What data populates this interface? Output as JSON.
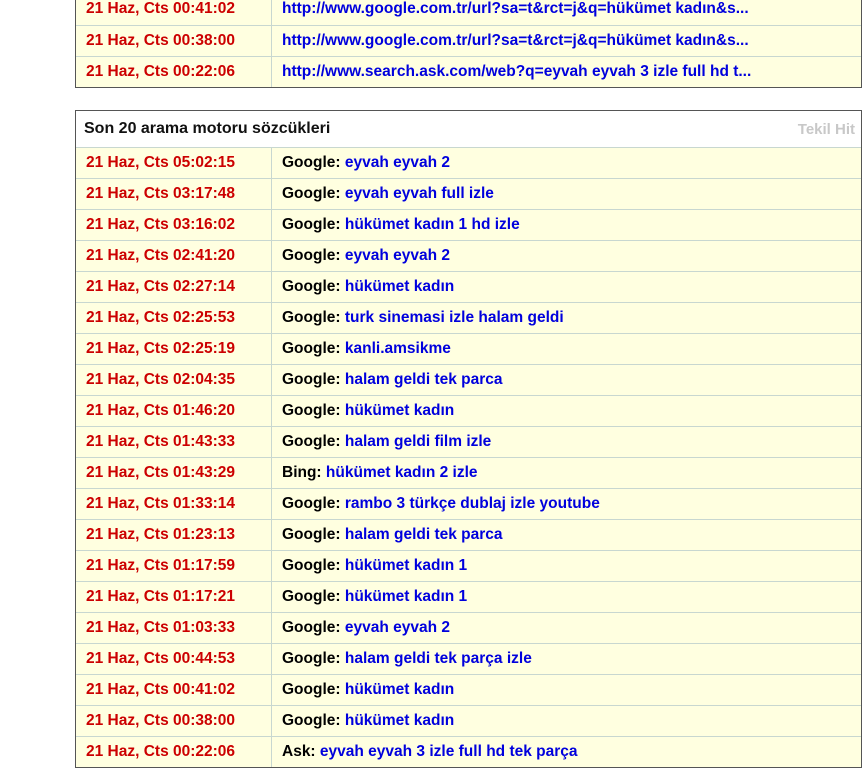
{
  "referrers": [
    {
      "date": "21 Haz, Cts 00:41:02",
      "url": "http://www.google.com.tr/url?sa=t&rct=j&q=hükümet kadın&s..."
    },
    {
      "date": "21 Haz, Cts 00:38:00",
      "url": "http://www.google.com.tr/url?sa=t&rct=j&q=hükümet kadın&s..."
    },
    {
      "date": "21 Haz, Cts 00:22:06",
      "url": "http://www.search.ask.com/web?q=eyvah eyvah 3 izle full hd t..."
    }
  ],
  "search_panel": {
    "title": "Son 20 arama motoru sözcükleri",
    "meta": "Tekil Hit",
    "rows": [
      {
        "date": "21 Haz, Cts 05:02:15",
        "engine": "Google:",
        "keyword": "eyvah eyvah 2"
      },
      {
        "date": "21 Haz, Cts 03:17:48",
        "engine": "Google:",
        "keyword": "eyvah eyvah full izle"
      },
      {
        "date": "21 Haz, Cts 03:16:02",
        "engine": "Google:",
        "keyword": "hükümet kadın 1 hd izle"
      },
      {
        "date": "21 Haz, Cts 02:41:20",
        "engine": "Google:",
        "keyword": "eyvah eyvah 2"
      },
      {
        "date": "21 Haz, Cts 02:27:14",
        "engine": "Google:",
        "keyword": "hükümet kadın"
      },
      {
        "date": "21 Haz, Cts 02:25:53",
        "engine": "Google:",
        "keyword": "turk sinemasi izle halam geldi"
      },
      {
        "date": "21 Haz, Cts 02:25:19",
        "engine": "Google:",
        "keyword": "kanli.amsikme"
      },
      {
        "date": "21 Haz, Cts 02:04:35",
        "engine": "Google:",
        "keyword": "halam geldi tek parca"
      },
      {
        "date": "21 Haz, Cts 01:46:20",
        "engine": "Google:",
        "keyword": "hükümet kadın"
      },
      {
        "date": "21 Haz, Cts 01:43:33",
        "engine": "Google:",
        "keyword": "halam geldi film izle"
      },
      {
        "date": "21 Haz, Cts 01:43:29",
        "engine": "Bing:",
        "keyword": "hükümet kadın 2 izle"
      },
      {
        "date": "21 Haz, Cts 01:33:14",
        "engine": "Google:",
        "keyword": "rambo 3 türkçe dublaj izle youtube"
      },
      {
        "date": "21 Haz, Cts 01:23:13",
        "engine": "Google:",
        "keyword": "halam geldi tek parca"
      },
      {
        "date": "21 Haz, Cts 01:17:59",
        "engine": "Google:",
        "keyword": "hükümet kadın 1"
      },
      {
        "date": "21 Haz, Cts 01:17:21",
        "engine": "Google:",
        "keyword": "hükümet kadın 1"
      },
      {
        "date": "21 Haz, Cts 01:03:33",
        "engine": "Google:",
        "keyword": "eyvah eyvah 2"
      },
      {
        "date": "21 Haz, Cts 00:44:53",
        "engine": "Google:",
        "keyword": "halam geldi tek parça izle"
      },
      {
        "date": "21 Haz, Cts 00:41:02",
        "engine": "Google:",
        "keyword": "hükümet kadın"
      },
      {
        "date": "21 Haz, Cts 00:38:00",
        "engine": "Google:",
        "keyword": "hükümet kadın"
      },
      {
        "date": "21 Haz, Cts 00:22:06",
        "engine": "Ask:",
        "keyword": "eyvah eyvah 3 izle full hd tek parça"
      }
    ]
  },
  "colors": {
    "date_red": "#cc0000",
    "link_blue": "#0000dd",
    "row_bg": "#ffffe0",
    "divider": "#c8d7d0"
  }
}
